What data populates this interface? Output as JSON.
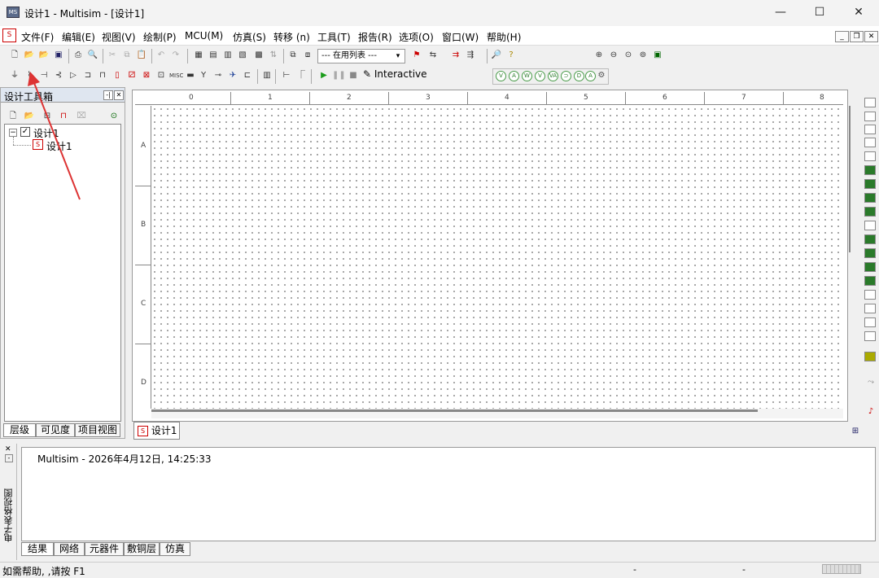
{
  "window": {
    "title": "设计1 - Multisim - [设计1]",
    "app_icon_label": "MS"
  },
  "menu": [
    "文件(F)",
    "编辑(E)",
    "视图(V)",
    "绘制(P)",
    "MCU(M)",
    "仿真(S)",
    "转移 (n)",
    "工具(T)",
    "报告(R)",
    "选项(O)",
    "窗口(W)",
    "帮助(H)"
  ],
  "toolbar": {
    "in_use_list": "--- 在用列表 ---",
    "interactive_label": "Interactive"
  },
  "toolbox": {
    "title": "设计工具箱",
    "root": "设计1",
    "child": "设计1",
    "tabs": [
      "层级",
      "可见度",
      "项目视图"
    ]
  },
  "canvas": {
    "col_labels": [
      "0",
      "1",
      "2",
      "3",
      "4",
      "5",
      "6",
      "7",
      "8"
    ],
    "row_labels": [
      "A",
      "B",
      "C",
      "D"
    ],
    "doc_tab": "设计1"
  },
  "spreadsheet": {
    "side_title": "电子表格视图",
    "output_line": "Multisim  -  2026年4月12日, 14:25:33",
    "tabs": [
      "结果",
      "网络",
      "元器件",
      "敷铜层",
      "仿真"
    ]
  },
  "status": {
    "help_text": "如需帮助, ,请按 F1",
    "dash1": "-",
    "dash2": "-"
  },
  "icons": {
    "minimize": "minimize-icon",
    "maximize": "maximize-icon",
    "close": "close-icon"
  }
}
